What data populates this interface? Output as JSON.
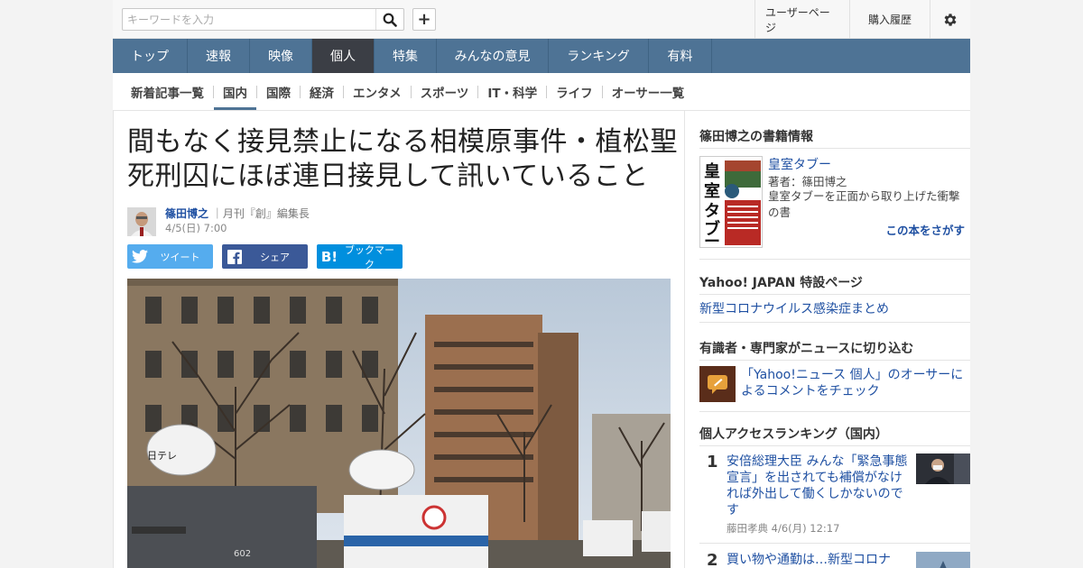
{
  "header": {
    "search_placeholder": "キーワードを入力",
    "search_icon": "search-icon",
    "add_icon": "plus-icon",
    "add_label": "+",
    "user_page": "ユーザーページ",
    "purchase_history": "購入履歴",
    "settings_icon": "gear-icon"
  },
  "main_nav": {
    "items": [
      {
        "label": "トップ"
      },
      {
        "label": "速報"
      },
      {
        "label": "映像"
      },
      {
        "label": "個人"
      },
      {
        "label": "特集"
      },
      {
        "label": "みんなの意見"
      },
      {
        "label": "ランキング"
      },
      {
        "label": "有料"
      }
    ],
    "active": "個人"
  },
  "sub_nav": {
    "items": [
      {
        "label": "新着記事一覧"
      },
      {
        "label": "国内"
      },
      {
        "label": "国際"
      },
      {
        "label": "経済"
      },
      {
        "label": "エンタメ"
      },
      {
        "label": "スポーツ"
      },
      {
        "label": "IT・科学"
      },
      {
        "label": "ライフ"
      },
      {
        "label": "オーサー一覧"
      }
    ],
    "active": "国内"
  },
  "article": {
    "title_line1": "間もなく接見禁止になる相模原事件・植松聖",
    "title_line2": "死刑囚にほぼ連日接見して訊いていること",
    "author_name": "篠田博之",
    "author_role": "｜月刊『創』編集長",
    "date": "4/5(日) 7:00",
    "share": {
      "tweet": "ツイート",
      "facebook": "シェア",
      "hatena": "ブックマーク",
      "hatena_glyph": "B!"
    },
    "photo_caption_tags": [
      "日テレ",
      "602"
    ]
  },
  "sidebar": {
    "book_section": {
      "title": "篠田博之の書籍情報",
      "book_title": "皇室タブー",
      "book_author": "著者：篠田博之",
      "book_desc": "皇室タブーを正面から取り上げた衝撃の書",
      "find_link": "この本をさがす",
      "cover_text": "皇室タブー"
    },
    "special_section": {
      "title": "Yahoo! JAPAN 特設ページ",
      "link": "新型コロナウイルス感染症まとめ"
    },
    "expert_section": {
      "title": "有識者・専門家がニュースに切り込む",
      "link": "「Yahoo!ニュース 個人」のオーサーによるコメントをチェック"
    },
    "ranking_section": {
      "title": "個人アクセスランキング（国内）",
      "items": [
        {
          "rank": "1",
          "title": "安倍総理大臣 みんな「緊急事態宣言」を出されても補償がなければ外出して働くしかないのです",
          "meta": "藤田孝典 4/6(月) 12:17"
        },
        {
          "rank": "2",
          "title": "買い物や通勤は…新型コロナ",
          "meta": ""
        }
      ]
    }
  },
  "colors": {
    "nav_bg": "#4e7395",
    "nav_active": "#3b3e45",
    "link": "#1f50a2",
    "twitter": "#55acee",
    "facebook": "#3b5998",
    "hatena": "#008fde"
  }
}
